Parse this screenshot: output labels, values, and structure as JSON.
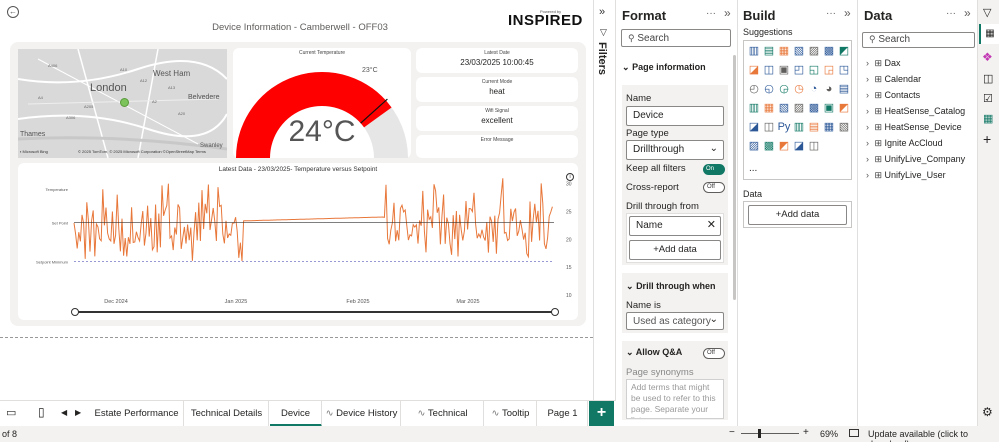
{
  "report": {
    "title": "Device Information  - Camberwell - OFF03",
    "brand_small": "Powered by",
    "brand": "INSPIRED",
    "map": {
      "labels": [
        "West Ham",
        "London",
        "Belvedere",
        "Thames",
        "Swanley"
      ],
      "roads": [
        "A406",
        "A10",
        "A12",
        "A13",
        "A2",
        "A20",
        "A205",
        "A306",
        "A4"
      ],
      "attribution": "© 2025 TomTom, © 2025 Microsoft Corporation ©OpenStreetMap  Terms"
    },
    "gauge": {
      "caption": "Current Temperature",
      "value_text": "24°C",
      "target_text": "23°C",
      "value": 24,
      "target": 23,
      "max": 30,
      "fill_color": "#ff0000",
      "bg_color": "#e6e6e6"
    },
    "info_cards": [
      {
        "caption": "Latest Date",
        "value": "23/03/2025 10:00:45"
      },
      {
        "caption": "Current Mode",
        "value": "heat"
      },
      {
        "caption": "Wifi Signal",
        "value": "excellent"
      },
      {
        "caption": "Error Message",
        "value": ""
      }
    ]
  },
  "chart_data": {
    "type": "line",
    "title": "Latest Data - 23/03/2025- Temperature versus Setpoint",
    "x_ticks": [
      "Dec 2024",
      "Jan 2025",
      "Feb 2025",
      "Mar 2025"
    ],
    "y_ticks": [
      "30",
      "25",
      "20",
      "15",
      "10"
    ],
    "ylim": [
      10,
      31
    ],
    "left_labels": [
      "Temperature",
      "Set Point",
      "Setpoint Minimum"
    ],
    "series": [
      {
        "name": "Temperature",
        "color": "#e8773a"
      },
      {
        "name": "Set Point",
        "color": "#333333"
      },
      {
        "name": "Setpoint Minimum",
        "color": "#8a8acf"
      }
    ],
    "setpoint_value": 23,
    "setpoint_minimum_value": 16
  },
  "filters_label": "Filters",
  "format_pane": {
    "title": "Format",
    "search_placeholder": "Search",
    "section_page_info": "Page information",
    "name_label": "Name",
    "name_value": "Device",
    "page_type_label": "Page type",
    "page_type_value": "Drillthrough",
    "keep_filters_label": "Keep all filters",
    "keep_filters_toggle": "On",
    "cross_report_label": "Cross-report",
    "cross_report_toggle": "Off",
    "drill_from_label": "Drill through from",
    "drill_field": "Name",
    "add_data_label": "+Add data",
    "section_drill_when": "Drill through when",
    "name_is_label": "Name is",
    "name_is_value": "Used as category",
    "section_qa": "Allow Q&A",
    "qa_toggle": "Off",
    "page_synonyms_label": "Page synonyms",
    "page_synonyms_placeholder": "Add terms that might be used to refer to this page. Separate your list"
  },
  "build_pane": {
    "title": "Build",
    "suggestions_label": "Suggestions",
    "more_label": "...",
    "data_label": "Data",
    "add_data_label": "+Add data"
  },
  "data_pane": {
    "title": "Data",
    "search_placeholder": "Search",
    "tables": [
      "Dax",
      "Calendar",
      "Contacts",
      "HeatSense_Catalog",
      "HeatSense_Device",
      "Ignite AcCloud",
      "UnifyLive_Company",
      "UnifyLive_User"
    ]
  },
  "tabs": [
    "Estate Performance",
    "Technical Details",
    "Device",
    "Device History",
    "Technical Details",
    "Tooltip",
    "Page 1"
  ],
  "active_tab": "Device",
  "status": {
    "page_of": "of 8",
    "zoom": "69%",
    "update": "Update available (click to download)"
  }
}
